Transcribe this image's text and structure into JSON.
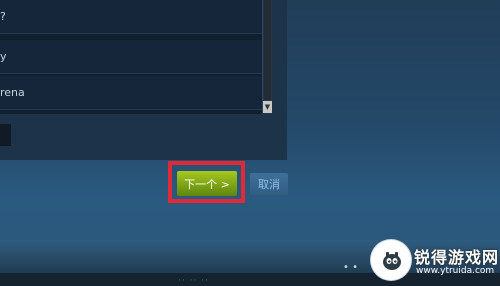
{
  "list": {
    "items": [
      {
        "label": "?"
      },
      {
        "label": "y"
      },
      {
        "label": "rena"
      }
    ]
  },
  "buttons": {
    "next_label": "下一个 >",
    "cancel_label": "取消"
  },
  "watermark": {
    "brand": "锐得游戏网",
    "url": "www.ytruida.com"
  },
  "footer": {
    "text": "·· ·· ··"
  }
}
